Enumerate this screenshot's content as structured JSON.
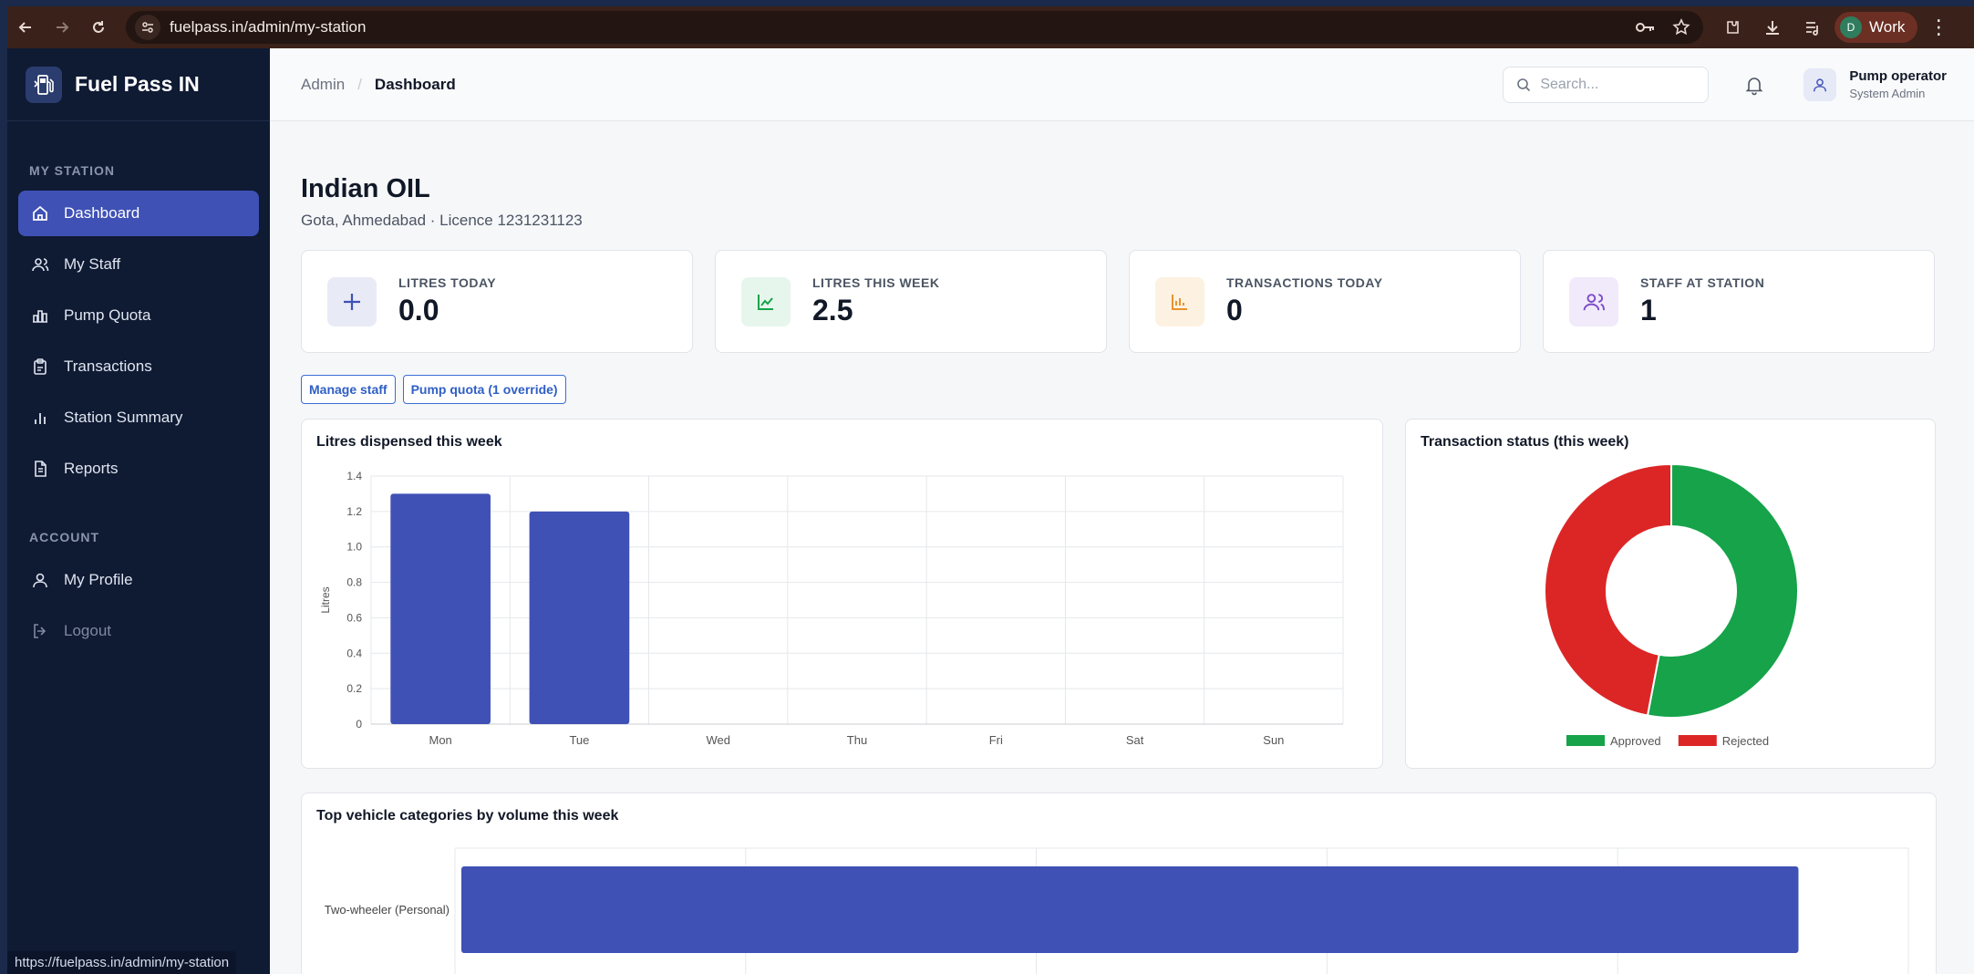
{
  "browser": {
    "url": "fuelpass.in/admin/my-station",
    "profile_label": "Work",
    "profile_initial": "D",
    "status_url": "https://fuelpass.in/admin/my-station"
  },
  "sidebar": {
    "brand": "Fuel Pass IN",
    "section_station": "MY STATION",
    "section_account": "ACCOUNT",
    "items": [
      {
        "label": "Dashboard",
        "icon": "home-icon"
      },
      {
        "label": "My Staff",
        "icon": "users-icon"
      },
      {
        "label": "Pump Quota",
        "icon": "bar-chart-icon"
      },
      {
        "label": "Transactions",
        "icon": "clipboard-icon"
      },
      {
        "label": "Station Summary",
        "icon": "chart-icon"
      },
      {
        "label": "Reports",
        "icon": "document-icon"
      }
    ],
    "account_items": [
      {
        "label": "My Profile",
        "icon": "user-icon"
      },
      {
        "label": "Logout",
        "icon": "logout-icon"
      }
    ]
  },
  "topbar": {
    "breadcrumb_root": "Admin",
    "breadcrumb_current": "Dashboard",
    "search_placeholder": "Search...",
    "user_name": "Pump operator",
    "user_role": "System Admin"
  },
  "station": {
    "name": "Indian OIL",
    "subtitle": "Gota, Ahmedabad · Licence 1231231123"
  },
  "stats": [
    {
      "label": "LITRES TODAY",
      "value": "0.0",
      "icon": "plus-icon",
      "color": "#3f51b5",
      "bg": "#e8eaf6"
    },
    {
      "label": "LITRES THIS WEEK",
      "value": "2.5",
      "icon": "trend-icon",
      "color": "#16a34a",
      "bg": "#e6f6ec"
    },
    {
      "label": "TRANSACTIONS TODAY",
      "value": "0",
      "icon": "bar-icon",
      "color": "#e8942a",
      "bg": "#fdf1e2"
    },
    {
      "label": "STAFF AT STATION",
      "value": "1",
      "icon": "users-icon",
      "color": "#7c4dca",
      "bg": "#f0eafa"
    }
  ],
  "actions": {
    "manage_staff": "Manage staff",
    "pump_quota": "Pump quota (1 override)"
  },
  "charts": {
    "litres_title": "Litres dispensed this week",
    "status_title": "Transaction status (this week)",
    "vehicles_title": "Top vehicle categories by volume this week"
  },
  "chart_data": [
    {
      "type": "bar",
      "title": "Litres dispensed this week",
      "categories": [
        "Mon",
        "Tue",
        "Wed",
        "Thu",
        "Fri",
        "Sat",
        "Sun"
      ],
      "values": [
        1.3,
        1.2,
        0,
        0,
        0,
        0,
        0
      ],
      "ylabel": "Litres",
      "ylim": [
        0,
        1.4
      ],
      "yticks": [
        "0",
        "0.2",
        "0.4",
        "0.6",
        "0.8",
        "1.0",
        "1.2",
        "1.4"
      ],
      "color": "#3f51b5",
      "grid": true
    },
    {
      "type": "pie",
      "title": "Transaction status (this week)",
      "labels": [
        "Approved",
        "Rejected"
      ],
      "values": [
        53,
        47
      ],
      "colors": [
        "#16a34a",
        "#dc2626"
      ],
      "donut": true,
      "legend": "bottom"
    },
    {
      "type": "bar",
      "orientation": "horizontal",
      "title": "Top vehicle categories by volume this week",
      "categories": [
        "Two-wheeler (Personal)"
      ],
      "values": [
        1
      ],
      "color": "#3f51b5"
    }
  ]
}
